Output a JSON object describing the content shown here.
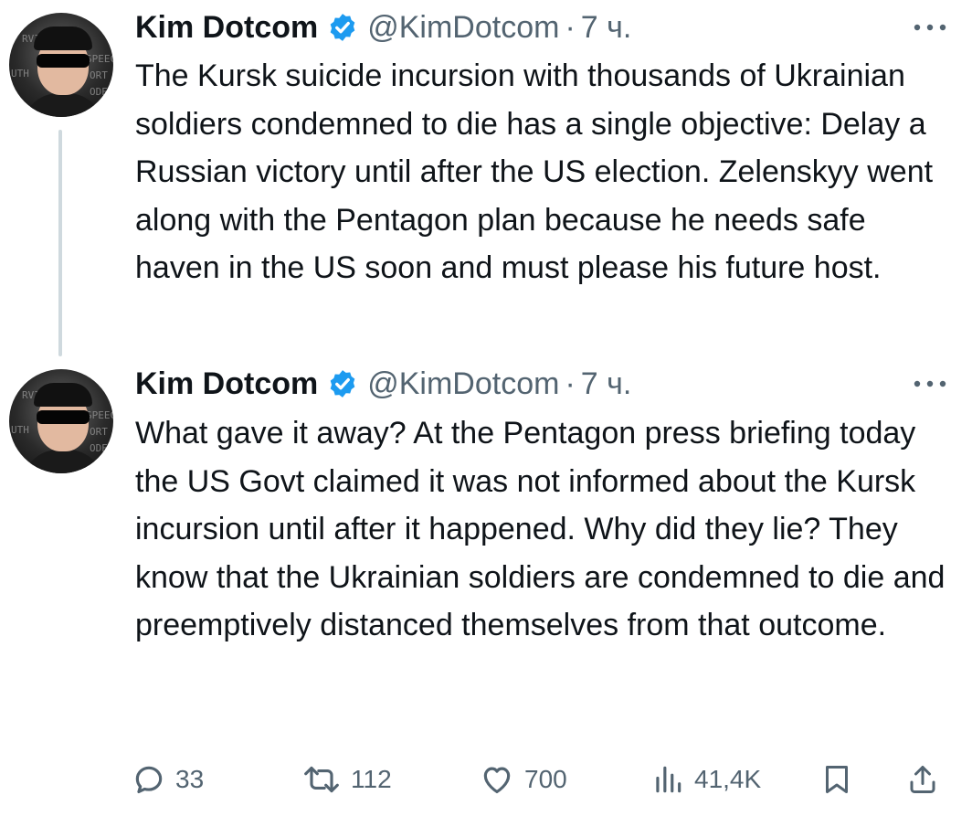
{
  "tweets": [
    {
      "author_name": "Kim Dotcom",
      "handle": "@KimDotcom",
      "separator": "·",
      "time": "7 ч.",
      "text": "The Kursk suicide incursion with thousands of Ukrainian soldiers condemned to die has a single objective: Delay a Russian victory until after the US election. Zelenskyy went along with the Pentagon plan because he needs safe haven in the US soon and must please his future host."
    },
    {
      "author_name": "Kim Dotcom",
      "handle": "@KimDotcom",
      "separator": "·",
      "time": "7 ч.",
      "text": "What gave it away? At the Pentagon press briefing today the US Govt claimed it was not informed about the Kursk incursion until after it happened. Why did they lie? They know that the Ukrainian soldiers are condemned to die and preemptively distanced themselves from that outcome."
    }
  ],
  "avatar_text": [
    "RVIS",
    "UTH",
    "SPEEC",
    "ORT",
    "ODEC"
  ],
  "actions": {
    "replies": "33",
    "reposts": "112",
    "likes": "700",
    "views": "41,4K"
  },
  "icons": {
    "verified": "verified-badge-icon",
    "more": "more-dots-icon",
    "reply": "reply-bubble-icon",
    "repost": "repost-arrows-icon",
    "like": "heart-icon",
    "views": "views-bar-chart-icon",
    "bookmark": "bookmark-icon",
    "share": "share-upload-icon"
  },
  "colors": {
    "verified_blue": "#1d9bf0",
    "secondary_text": "#536471",
    "primary_text": "#0f1419",
    "thread_line": "#cfd9de"
  }
}
